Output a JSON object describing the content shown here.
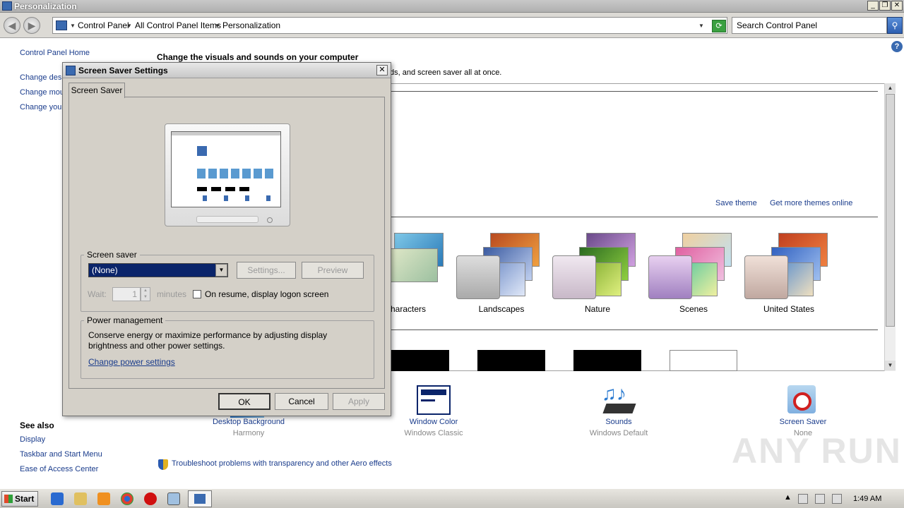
{
  "window": {
    "title": "Personalization"
  },
  "address": {
    "crumbs": [
      "Control Panel",
      "All Control Panel Items",
      "Personalization"
    ],
    "search_placeholder": "Search Control Panel"
  },
  "left_pane": {
    "home": "Control Panel Home",
    "links": [
      "Change desktop icons",
      "Change mouse pointers",
      "Change your account picture"
    ],
    "see_also_title": "See also",
    "see_also": [
      "Display",
      "Taskbar and Start Menu",
      "Ease of Access Center"
    ]
  },
  "main": {
    "heading": "Change the visuals and sounds on your computer",
    "subheading": "ds, and screen saver all at once.",
    "save_theme": "Save theme",
    "get_more": "Get more themes online",
    "themes": [
      "haracters",
      "Landscapes",
      "Nature",
      "Scenes",
      "United States"
    ],
    "troubleshoot": "Troubleshoot problems with transparency and other Aero effects"
  },
  "bottom": [
    {
      "label": "Desktop Background",
      "sub": "Harmony",
      "icon": "desktop-background-icon"
    },
    {
      "label": "Window Color",
      "sub": "Windows Classic",
      "icon": "window-color-icon"
    },
    {
      "label": "Sounds",
      "sub": "Windows Default",
      "icon": "sounds-icon"
    },
    {
      "label": "Screen Saver",
      "sub": "None",
      "icon": "screen-saver-icon"
    }
  ],
  "dialog": {
    "title": "Screen Saver Settings",
    "tab": "Screen Saver",
    "screen_saver_group": "Screen saver",
    "selected": "(None)",
    "settings_btn": "Settings...",
    "preview_btn": "Preview",
    "wait_label": "Wait:",
    "wait_value": "1",
    "minutes": "minutes",
    "resume_label": "On resume, display logon screen",
    "power_group": "Power management",
    "power_text": "Conserve energy or maximize performance by adjusting display brightness and other power settings.",
    "power_link": "Change power settings",
    "ok": "OK",
    "cancel": "Cancel",
    "apply": "Apply"
  },
  "taskbar": {
    "start": "Start",
    "clock": "1:49 AM"
  },
  "watermark": "ANY RUN"
}
